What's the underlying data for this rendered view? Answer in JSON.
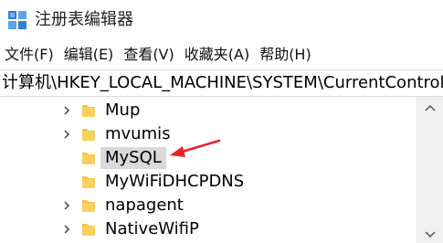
{
  "window": {
    "title": "注册表编辑器",
    "icon": "regedit-icon"
  },
  "menu": [
    {
      "label": "文件(F)"
    },
    {
      "label": "编辑(E)"
    },
    {
      "label": "查看(V)"
    },
    {
      "label": "收藏夹(A)"
    },
    {
      "label": "帮助(H)"
    }
  ],
  "address": {
    "path": "计算机\\HKEY_LOCAL_MACHINE\\SYSTEM\\CurrentControlSet\\Services"
  },
  "tree": {
    "items": [
      {
        "label": "Mup",
        "expandable": true,
        "selected": false
      },
      {
        "label": "mvumis",
        "expandable": true,
        "selected": false
      },
      {
        "label": "MySQL",
        "expandable": false,
        "selected": true
      },
      {
        "label": "MyWiFiDHCPDNS",
        "expandable": false,
        "selected": false
      },
      {
        "label": "napagent",
        "expandable": true,
        "selected": false
      },
      {
        "label": "NativeWifiP",
        "expandable": true,
        "selected": false
      }
    ]
  },
  "colors": {
    "folder": "#f4c64a",
    "selection": "#d9d9d9",
    "annotation_arrow": "#e8232a"
  }
}
